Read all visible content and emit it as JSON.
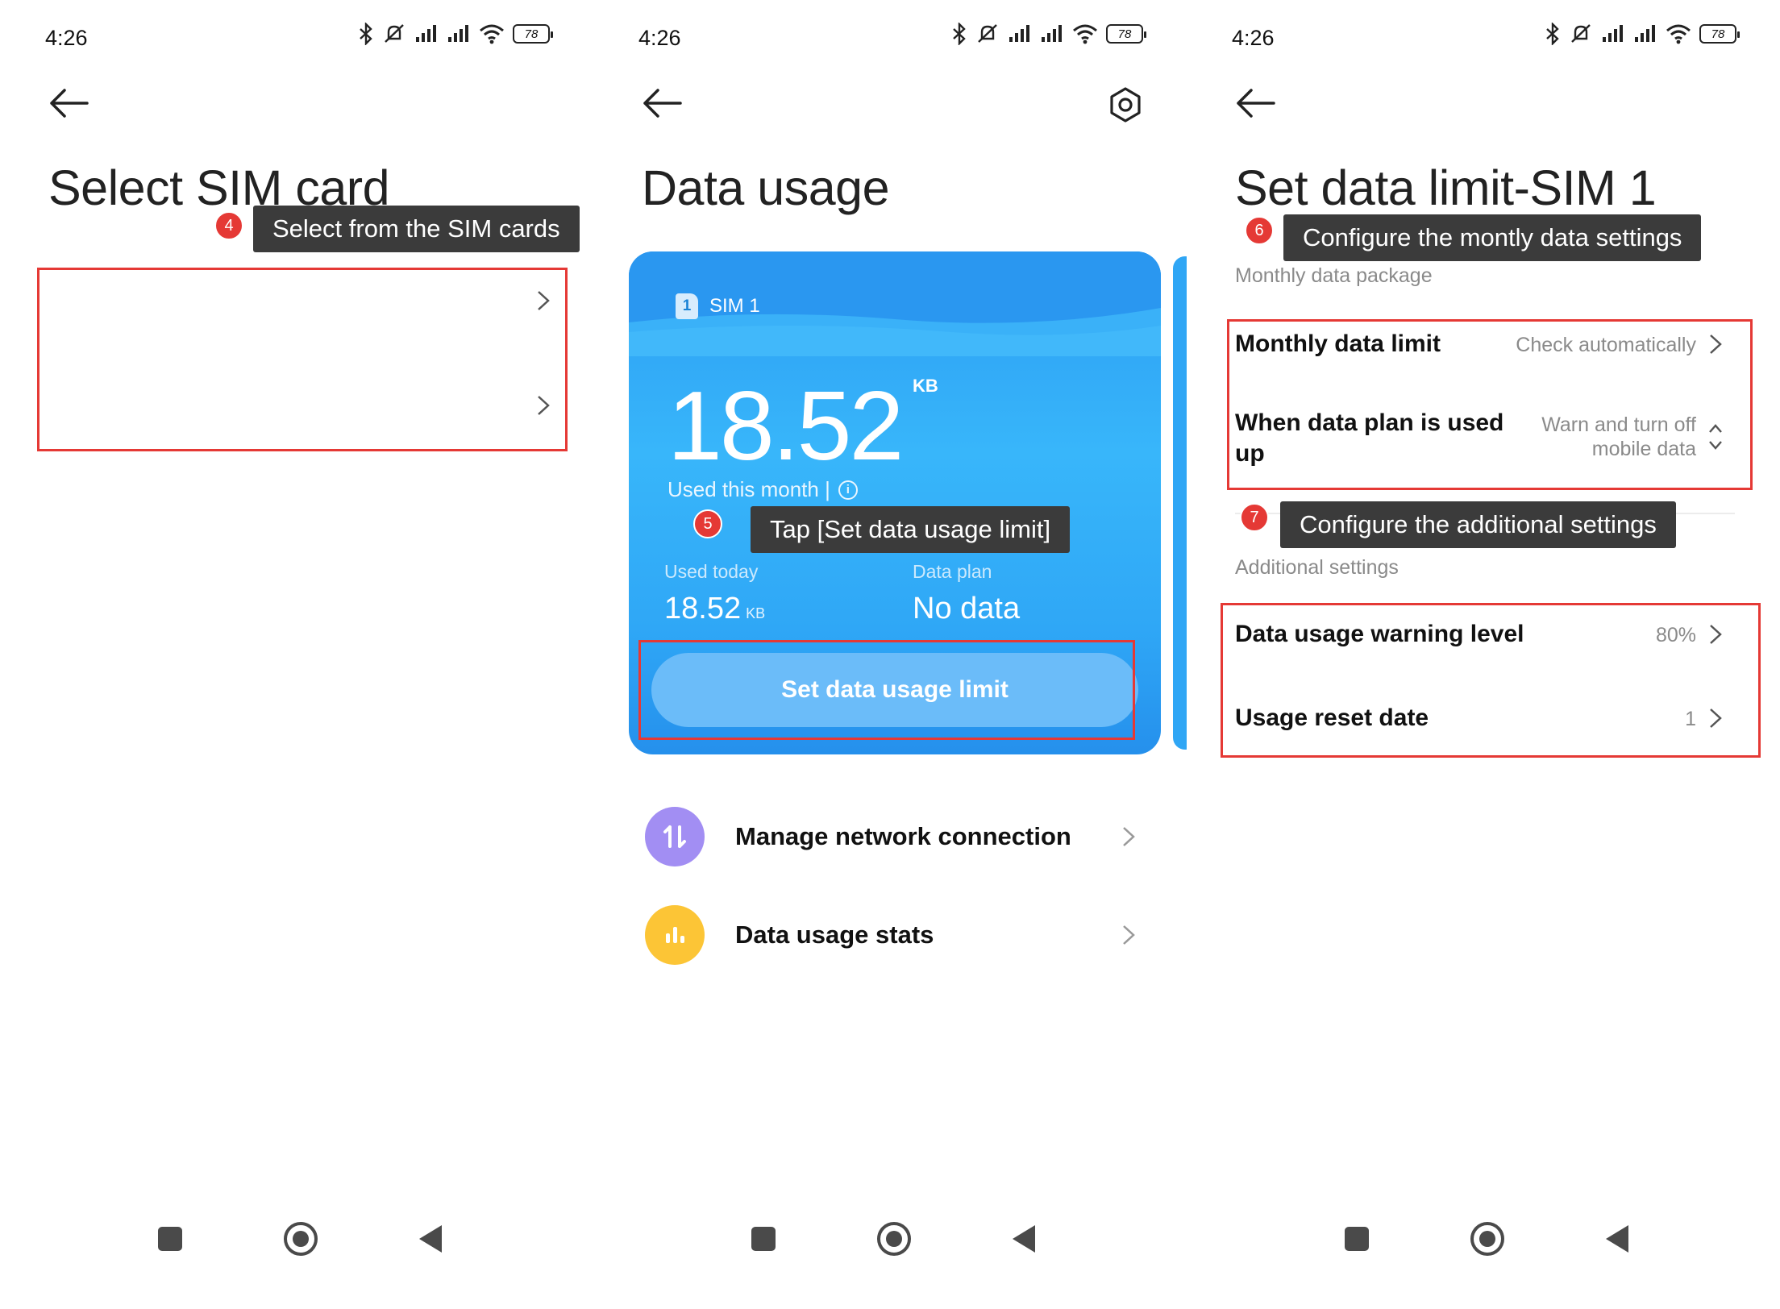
{
  "status": {
    "time": "4:26",
    "battery": "78"
  },
  "panel1": {
    "title": "Select SIM card",
    "step": "4",
    "tip": "Select from the SIM cards"
  },
  "panel2": {
    "title": "Data usage",
    "sim_label": "SIM 1",
    "sim_number": "1",
    "used_value": "18.52",
    "used_unit": "KB",
    "used_month_label": "Used this month |",
    "info_icon": "i",
    "step": "5",
    "tip": "Tap [Set data usage limit]",
    "used_today_label": "Used today",
    "used_today_value": "18.52",
    "used_today_unit": "KB",
    "data_plan_label": "Data plan",
    "data_plan_value": "No data",
    "set_limit_button": "Set data usage limit",
    "list": [
      {
        "label": "Manage network connection",
        "icon": "network-arrows-icon",
        "color": "#a28ef3"
      },
      {
        "label": "Data usage stats",
        "icon": "bar-chart-icon",
        "color": "#fcc536"
      }
    ]
  },
  "panel3": {
    "title": "Set data limit-SIM 1",
    "step6": "6",
    "tip6": "Configure the montly data settings",
    "section_monthly": "Monthly data package",
    "monthly_limit_label": "Monthly data limit",
    "monthly_limit_value": "Check automatically",
    "plan_used_label_1": "When data plan is used",
    "plan_used_label_2": "up",
    "plan_used_value_1": "Warn and turn off",
    "plan_used_value_2": "mobile data",
    "step7": "7",
    "tip7": "Configure the additional settings",
    "section_additional": "Additional settings",
    "warning_label": "Data usage warning level",
    "warning_value": "80%",
    "reset_label": "Usage reset date",
    "reset_value": "1"
  },
  "colors": {
    "accent_red": "#e53935",
    "card_blue": "#2fa7f6",
    "tip_bg": "#3b3b3b"
  }
}
